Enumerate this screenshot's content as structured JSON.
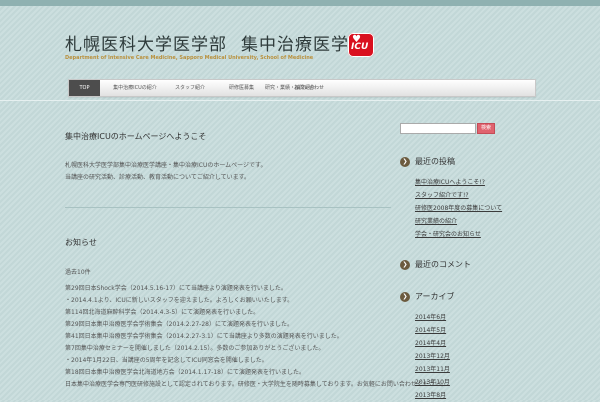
{
  "site": {
    "title_part1": "札幌医科大学医学部",
    "title_part2": "集中治療医学",
    "subtitle": "Department of Intensive Care Medicine, Sapporo Medical University, School of Medicine",
    "logo_text": "ICU",
    "logo_heart": "♥"
  },
  "nav": {
    "items": [
      {
        "label": "TOP",
        "active": true
      },
      {
        "label": "集中治療ICUの紹介"
      },
      {
        "label": "スタッフ紹介"
      },
      {
        "label": "研修医募集"
      },
      {
        "label": "研究・業績・論文紹介"
      },
      {
        "label": "お問い合わせ"
      }
    ]
  },
  "main": {
    "post_title": "集中治療ICUのホームページへようこそ",
    "post_body": [
      "札幌医科大学医学部集中治療医学講座・集中治療ICUのホームページです。",
      "当講座の研究活動、診療活動、教育活動についてご紹介しています。"
    ],
    "news_title": "お知らせ",
    "news_count": "過去10件",
    "news_items": [
      "第29回日本Shock学会（2014.5.16-17）にて当講座より演題発表を行いました。",
      "・2014.4.1より、ICUに新しいスタッフを迎えました。よろしくお願いいたします。",
      "第114回北海道麻酔科学会（2014.4.3-5）にて演題発表を行いました。",
      "第29回日本集中治療医学会学術集会（2014.2.27-28）にて演題発表を行いました。",
      "第41回日本集中治療医学会学術集会（2014.2.27-3.1）にて当講座より多数の演題発表を行いました。",
      "第7回集中治療セミナーを開催しました（2014.2.15）。多数のご参加ありがとうございました。",
      "・2014年1月22日、当講座の5周年を記念してICU同窓会を開催しました。",
      "第18回日本集中治療医学会北海道地方会（2014.1.17-18）にて演題発表を行いました。",
      "日本集中治療医学会専門医研修施設として認定されております。研修医・大学院生を随時募集しております。お気軽にお問い合わせください。"
    ]
  },
  "sidebar": {
    "search_button": "検索",
    "widget1_title": "最近の投稿",
    "widget1_items": [
      "集中治療ICUへようこそ!?",
      "スタッフ紹介です!?",
      "研修医2008年度の募集について",
      "研究業績の紹介",
      "学会・研究会のお知らせ"
    ],
    "widget2_title": "最近のコメント",
    "widget3_title": "アーカイブ",
    "archives": [
      "2014年6月",
      "2014年5月",
      "2014年4月",
      "2013年12月",
      "2013年11月",
      "2013年10月",
      "2013年8月"
    ],
    "bullet_glyph": "❯"
  },
  "colors": {
    "background": "#c6dbdb",
    "nav_active": "#4d4d4d",
    "search_button": "#e0626e",
    "logo": "#d9101f",
    "subtitle": "#b9913e",
    "widget_bullet": "#6b5a3e"
  }
}
